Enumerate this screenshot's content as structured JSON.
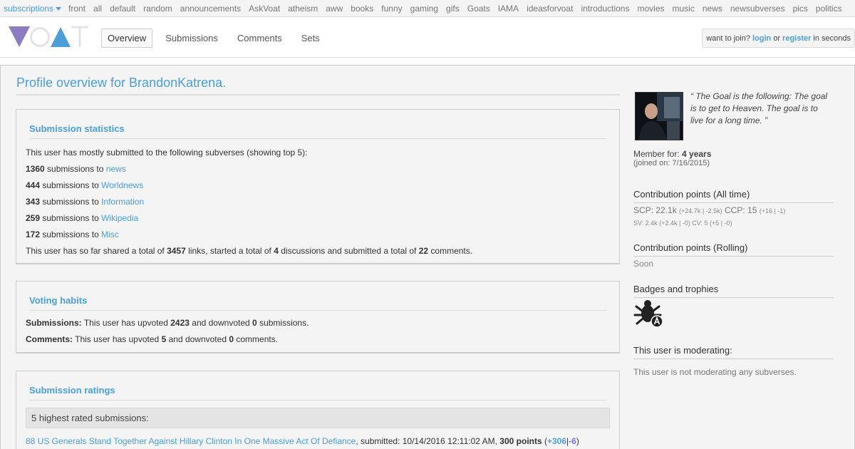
{
  "topbar": {
    "subscriptions": "subscriptions",
    "items": [
      "front",
      "all",
      "default",
      "random",
      "announcements",
      "AskVoat",
      "atheism",
      "aww",
      "books",
      "funny",
      "gaming",
      "gifs",
      "Goats",
      "IAMA",
      "ideasforvoat",
      "introductions",
      "movies",
      "music",
      "news",
      "newsubverses",
      "pics",
      "politics"
    ]
  },
  "header": {
    "tabs": [
      "Overview",
      "Submissions",
      "Comments",
      "Sets"
    ],
    "join": {
      "prefix": "want to join?",
      "login": "login",
      "or": "or",
      "register": "register",
      "suffix": "in seconds"
    }
  },
  "colors": {
    "brand_purple": "#8e7cc3",
    "brand_blue": "#4a9fd8",
    "link": "#4a9fd8"
  },
  "profile": {
    "title": "Profile overview for BrandonKatrena."
  },
  "stats": {
    "heading": "Submission statistics",
    "intro": "This user has mostly submitted to the following subverses (showing top 5):",
    "rows": [
      {
        "count": "1360",
        "mid": "submissions to",
        "sub": "news"
      },
      {
        "count": "444",
        "mid": "submissions to",
        "sub": "Worldnews"
      },
      {
        "count": "343",
        "mid": "submissions to",
        "sub": "Information"
      },
      {
        "count": "259",
        "mid": "submissions to",
        "sub": "Wikipedia"
      },
      {
        "count": "172",
        "mid": "submissions to",
        "sub": "Misc"
      }
    ],
    "total": {
      "a": "This user has so far shared a total of",
      "links": "3457",
      "b": "links, started a total of",
      "discussions": "4",
      "c": "discussions and submitted a total of",
      "comments": "22",
      "d": "comments."
    }
  },
  "voting": {
    "heading": "Voting habits",
    "sub_label": "Submissions:",
    "sub_a": "This user has upvoted",
    "sub_up": "2423",
    "sub_b": "and downvoted",
    "sub_down": "0",
    "sub_c": "submissions.",
    "com_label": "Comments:",
    "com_a": "This user has upvoted",
    "com_up": "5",
    "com_b": "and downvoted",
    "com_down": "0",
    "com_c": "comments."
  },
  "ratings": {
    "heading": "Submission ratings",
    "subheading": "5 highest rated submissions:",
    "top": {
      "title": "88 US Generals Stand Together Against Hillary Clinton In One Massive Act Of Defiance",
      "submitted": ", submitted: 10/14/2016 12:11:02 AM,",
      "points": "300 points",
      "open": "(",
      "up": "+306",
      "sep": "|",
      "down": "-6",
      "close": ")"
    }
  },
  "sidebar": {
    "quote": "“ The Goal is the following: The goal is to get to Heaven. The goal is to live for a long time. ”",
    "member_label": "Member for:",
    "member_value": "4 years",
    "joined": "(joined on: 7/16/2015)",
    "cp_all": "Contribution points (All time)",
    "scp_label": "SCP: 22.1k",
    "scp_small": "(+24.7k | -2.5k)",
    "ccp_label": "CCP: 15",
    "ccp_small": "(+16 | -1)",
    "sv_line": "SV: 2.4k (+2.4k | -0) CV: 5 (+5 | -0)",
    "cp_rolling": "Contribution points (Rolling)",
    "soon": "Soon",
    "badges": "Badges and trophies",
    "moderating": "This user is moderating:",
    "mod_text": "This user is not moderating any subverses."
  }
}
